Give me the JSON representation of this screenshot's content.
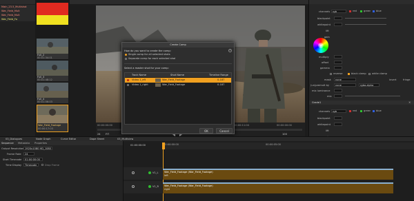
{
  "shot_bin": {
    "rows": [
      {
        "label": "Main_23.5_Multishot",
        "color": "#e04a3a"
      },
      {
        "label": "War_Field_Mult",
        "color": "#e04a3a"
      },
      {
        "label": "War_Field_Mult",
        "color": "#e04a3a"
      },
      {
        "label": "War_Field_Fo",
        "color": "#d6d63a"
      }
    ],
    "thumbs": [
      {
        "name": "Full_2",
        "info": "00:01:34:01"
      },
      {
        "name": "Full_3",
        "info": "00:01:48:12"
      },
      {
        "name": "Full_4",
        "info": "00:01:56:03"
      },
      {
        "name": "War_Field_Footage",
        "info": "00:00:17:03"
      }
    ]
  },
  "viewer": {
    "timecode_left": "00:00:00:00",
    "timecode_mid": "00:00:11:04",
    "timecode_right": "00:00:00:00",
    "fps": "24",
    "zoom": "FIT",
    "frame": "100"
  },
  "grade": {
    "title": "Grade1",
    "labels": {
      "channels": "channels",
      "blackpoint": "blackpoint",
      "whitepoint": "whitepoint",
      "lift": "lift",
      "gain": "gain",
      "multiply": "multiply",
      "offset": "offset",
      "gamma": "gamma",
      "reverse": "reverse",
      "black_clamp": "black clamp",
      "white_clamp": "white clamp",
      "mask": "mask",
      "unpremult": "(un)premult by",
      "mix_luminance": "mix luminance",
      "mix": "mix",
      "none": "none",
      "rgb": "rgb",
      "red": "red",
      "green": "green",
      "blue": "blue",
      "invert": "invert",
      "fringe": "fringe",
      "alpha": "rgba.alpha"
    },
    "colors": {
      "accent": "#f0a020",
      "red": "#d03030",
      "green": "#30c030",
      "blue": "#3060e0"
    }
  },
  "dialog": {
    "title": "Create Comp",
    "question": "How do you want to create the comp:",
    "option_single": "Single comp for all selected shots",
    "option_separate": "Separate comp for each selected shot",
    "master_prompt": "Select a master shot for your comp:",
    "columns": [
      "Track Name",
      "Shot Name",
      "Timeline Range"
    ],
    "rows": [
      {
        "track": "Video 1_eft",
        "shot": "War_Field_Footage",
        "range": "0-187",
        "selected": true
      },
      {
        "track": "Video 1_right",
        "shot": "War_Field_Footage",
        "range": "0-187",
        "selected": false
      }
    ],
    "ok": "OK",
    "cancel": "Cancel"
  },
  "tabs": {
    "left": [
      "Sequence",
      "Metadata",
      "Properties"
    ],
    "top": [
      "03_Dialogues",
      "Node Graph",
      "Curve Editor",
      "Dope Sheet",
      "03_Multiview"
    ]
  },
  "properties": {
    "output_resolution_label": "Output Resolution",
    "output_resolution_value": "1920x1080 HD_1080",
    "frame_rate_label": "Frame Rate",
    "frame_rate_value": "24",
    "start_timecode_label": "Start Timecode",
    "start_timecode_value": "01:00:00:00",
    "time_display_label": "Time Display",
    "time_display_value": "Timecode",
    "drop_frame": "Drop Frame"
  },
  "timeline": {
    "ruler_start": "00:00:00:00",
    "ruler_mid": "00:00:05:00",
    "playhead_tc": "01:00:00:00",
    "tracks": [
      {
        "name": "V1_L",
        "clip_title": "War_Field_Footage (War_Field_Footage)",
        "clip_sub": "left"
      },
      {
        "name": "V1_R",
        "clip_title": "War_Field_Footage (War_Field_Footage)",
        "clip_sub": "right"
      }
    ]
  }
}
